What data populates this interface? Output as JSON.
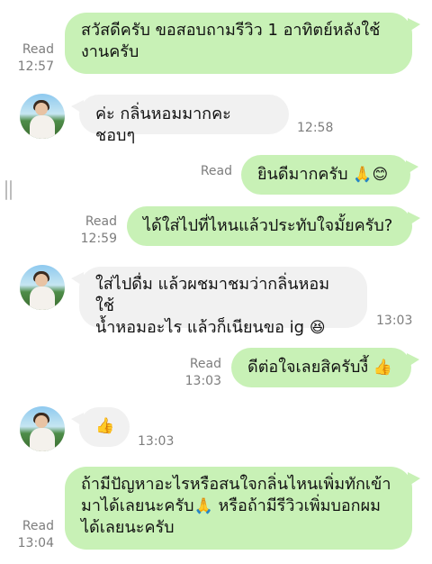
{
  "messages": [
    {
      "side": "out",
      "text_lines": [
        "สวัสดีครับ ขอสอบถามรีวิว 1 อาทิตย์หลังใช้",
        "งานครับ"
      ],
      "read": "Read",
      "time": "12:57"
    },
    {
      "side": "in",
      "text_lines": [
        "ค่ะ กลิ่นหอมมากคะ ชอบๆ"
      ],
      "time": "12:58"
    },
    {
      "side": "out",
      "text_lines": [
        "ยินดีมากครับ"
      ],
      "emoji": [
        "🙏",
        "😊"
      ],
      "read": "Read",
      "time": ""
    },
    {
      "side": "out",
      "text_lines": [
        "ได้ใส่ไปที่ไหนแล้วประทับใจมั้ยครับ?"
      ],
      "read": "Read",
      "time": "12:59"
    },
    {
      "side": "in",
      "text_lines": [
        "ใส่ไปดื่ม แล้วผชมาชมว่ากลิ่นหอม ใช้",
        "น้ำหอมอะไร แล้วก็เนียนขอ ig"
      ],
      "emoji": [
        "😆"
      ],
      "time": "13:03"
    },
    {
      "side": "out",
      "text_lines": [
        "ดีต่อใจเลยสิครับงี้"
      ],
      "emoji": [
        "👍"
      ],
      "read": "Read",
      "time": "13:03"
    },
    {
      "side": "in",
      "text_lines": [
        ""
      ],
      "emoji": [
        "👍"
      ],
      "time": "13:03"
    },
    {
      "side": "out",
      "text_lines": [
        "ถ้ามีปัญหาอะไรหรือสนใจกลิ่นไหนเพิ่มทักเข้า",
        "มาได้เลยนะครับ",
        "หรือถ้ามีรีวิวเพิ่มบอกผม",
        "ได้เลยนะครับ"
      ],
      "emoji": [
        "🙏"
      ],
      "read": "Read",
      "time": "13:04"
    }
  ],
  "colors": {
    "outgoing_bubble": "#c8f1b6",
    "incoming_bubble": "#f1f1f1",
    "meta_text": "#7d7d7d"
  }
}
